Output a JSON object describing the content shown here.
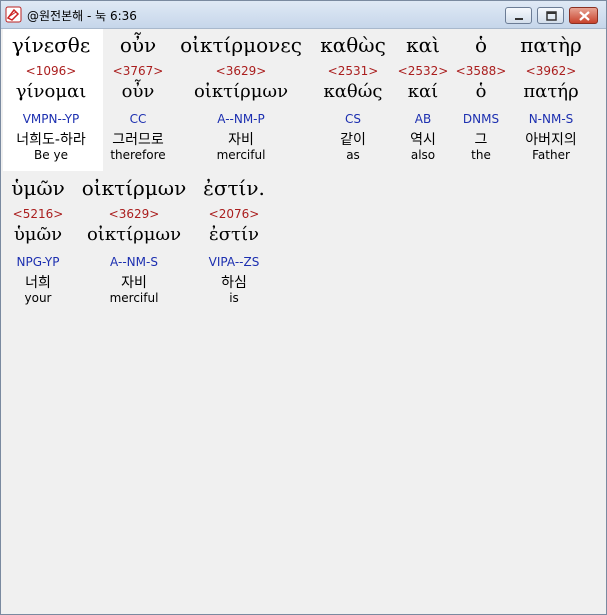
{
  "window": {
    "title": "@원전본해 - 눅 6:36"
  },
  "rows": [
    [
      {
        "greek": "γίνεσθε",
        "strong": "<1096>",
        "lemma": "γίνομαι",
        "parse": "VMPN--YP",
        "korean": "너희도-하라",
        "english": "Be ye"
      },
      {
        "greek": "οὖν",
        "strong": "<3767>",
        "lemma": "οὖν",
        "parse": "CC",
        "korean": "그러므로",
        "english": "therefore"
      },
      {
        "greek": "οἰκτίρμονες",
        "strong": "<3629>",
        "lemma": "οἰκτίρμων",
        "parse": "A--NM-P",
        "korean": "자비",
        "english": "merciful"
      },
      {
        "greek": "καθὼς",
        "strong": "<2531>",
        "lemma": "καθώς",
        "parse": "CS",
        "korean": "같이",
        "english": "as"
      },
      {
        "greek": "καὶ",
        "strong": "<2532>",
        "lemma": "καί",
        "parse": "AB",
        "korean": "역시",
        "english": "also"
      },
      {
        "greek": "ὁ",
        "strong": "<3588>",
        "lemma": "ὁ",
        "parse": "DNMS",
        "korean": "그",
        "english": "the"
      },
      {
        "greek": "πατὴρ",
        "strong": "<3962>",
        "lemma": "πατήρ",
        "parse": "N-NM-S",
        "korean": "아버지의",
        "english": "Father"
      }
    ],
    [
      {
        "greek": "ὑμῶν",
        "strong": "<5216>",
        "lemma": "ὑμῶν",
        "parse": "NPG-YP",
        "korean": "너희",
        "english": "your"
      },
      {
        "greek": "οἰκτίρμων",
        "strong": "<3629>",
        "lemma": "οἰκτίρμων",
        "parse": "A--NM-S",
        "korean": "자비",
        "english": "merciful"
      },
      {
        "greek": "ἐστίν.",
        "strong": "<2076>",
        "lemma": "ἐστίν",
        "parse": "VIPA--ZS",
        "korean": "하심",
        "english": "is"
      }
    ]
  ]
}
